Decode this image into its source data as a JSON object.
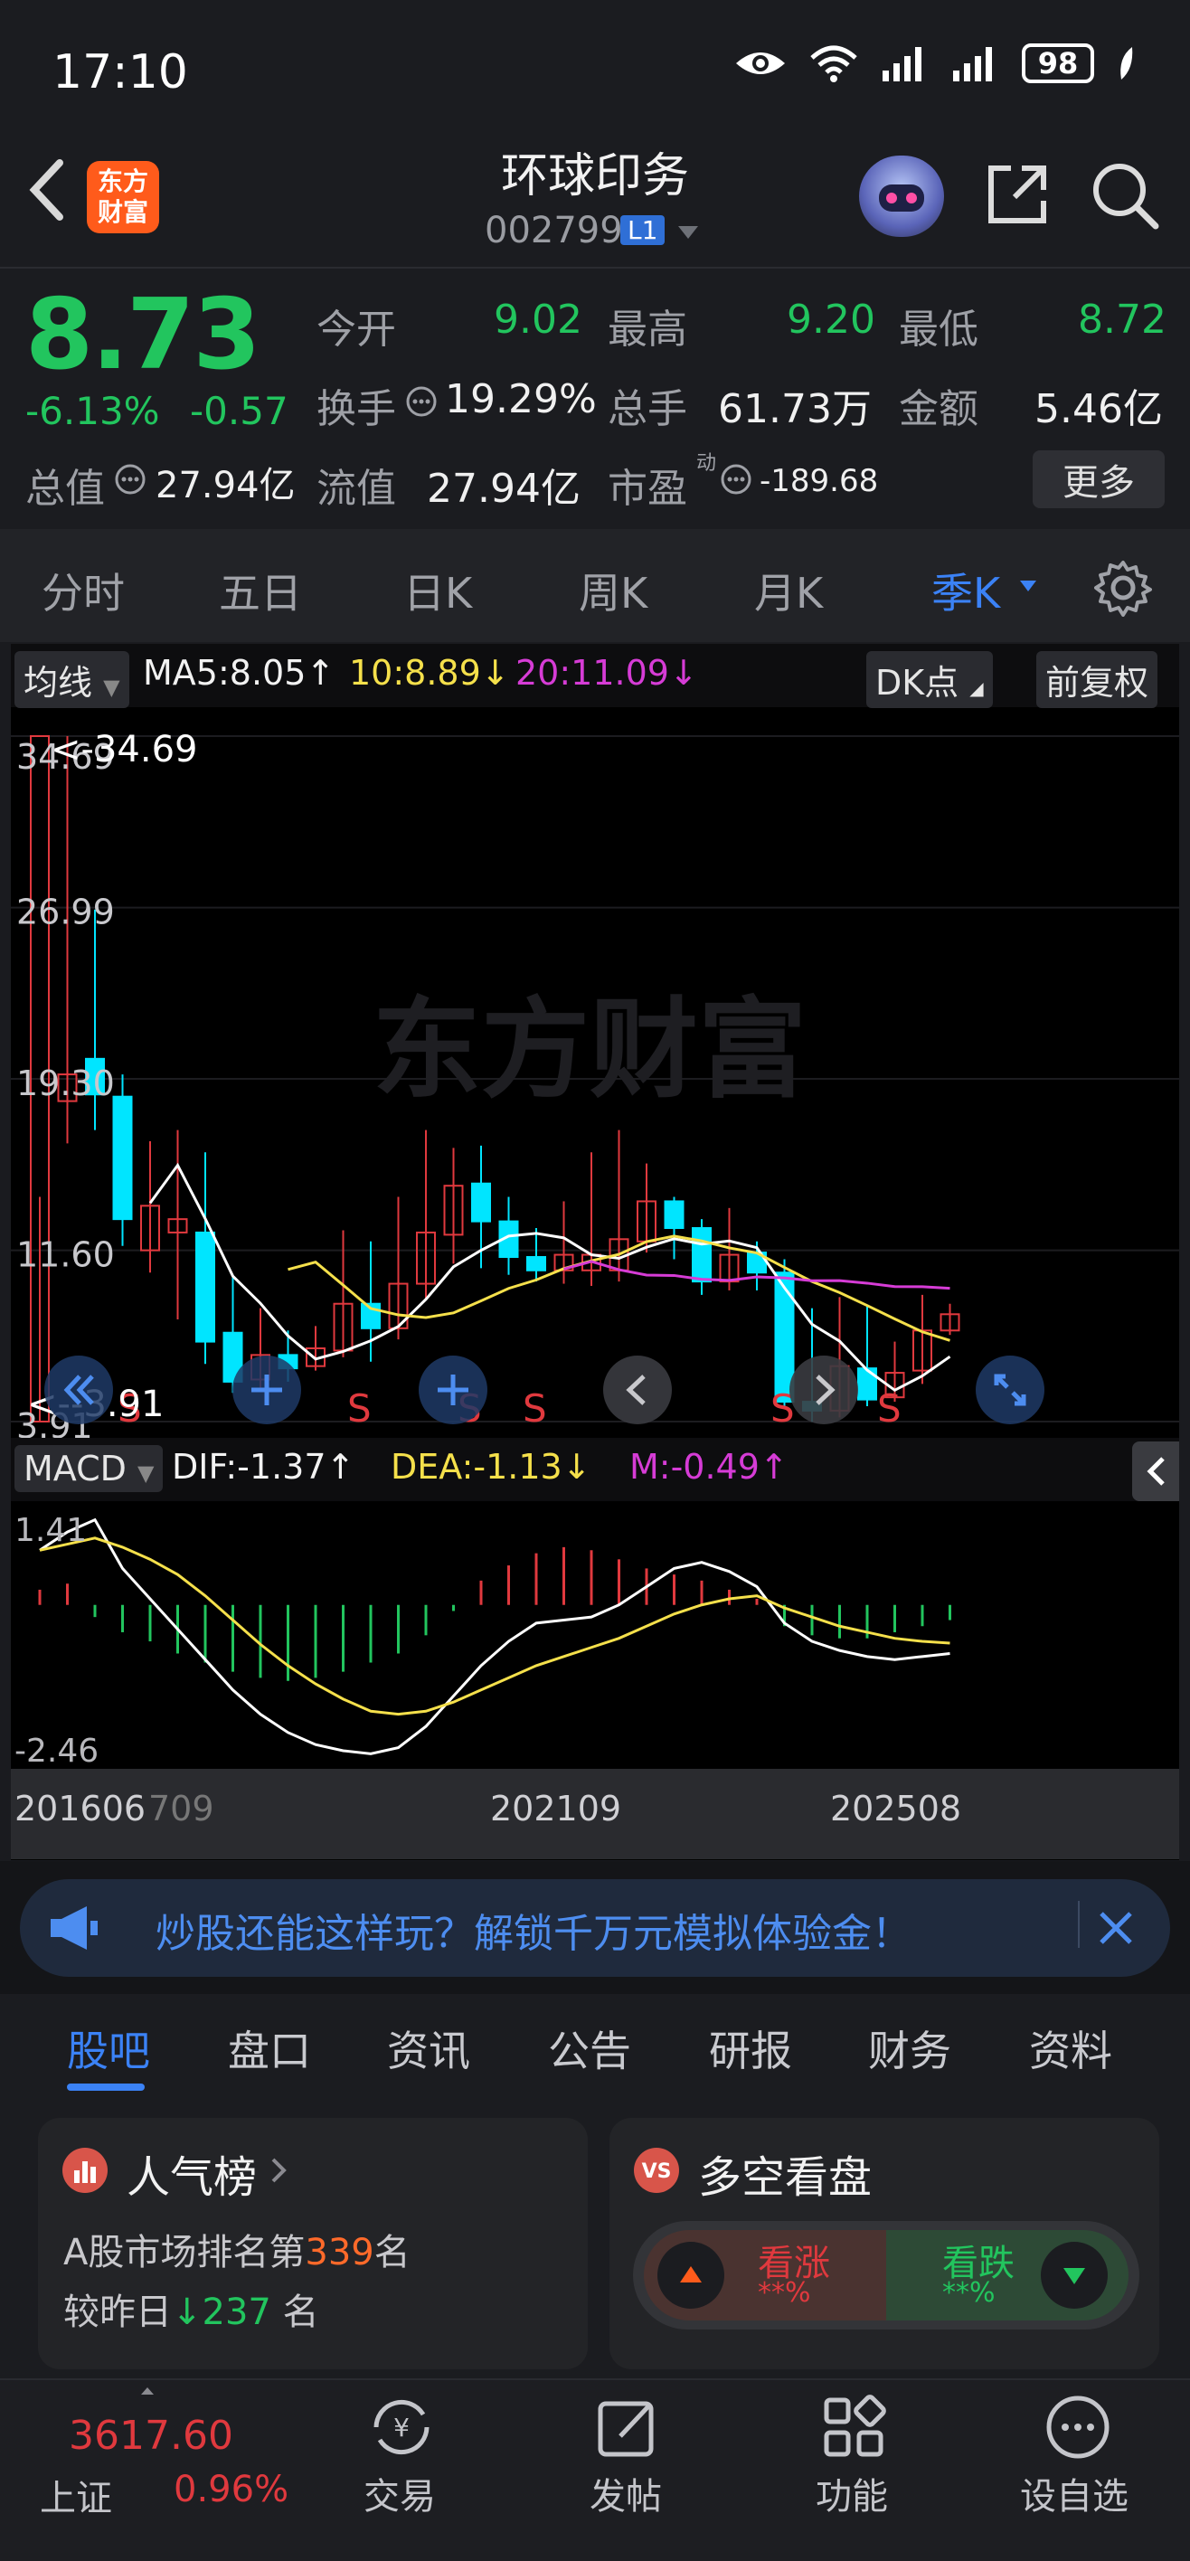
{
  "status": {
    "time": "17:10",
    "battery": "98"
  },
  "header": {
    "title": "环球印务",
    "code": "002799",
    "level": "L1",
    "logo_line1": "东方",
    "logo_line2": "财富"
  },
  "quote": {
    "price": "8.73",
    "pct": "-6.13%",
    "change": "-0.57",
    "open_label": "今开",
    "open": "9.02",
    "high_label": "最高",
    "high": "9.20",
    "low_label": "最低",
    "low": "8.72",
    "turnover_label": "换手",
    "turnover": "19.29%",
    "volume_label": "总手",
    "volume": "61.73万",
    "amount_label": "金额",
    "amount": "5.46亿",
    "mktcap_label": "总值",
    "mktcap": "27.94亿",
    "float_label": "流值",
    "float": "27.94亿",
    "pe_label": "市盈",
    "pe_sup": "动",
    "pe": "-189.68",
    "more": "更多"
  },
  "tabs": [
    "分时",
    "五日",
    "日K",
    "周K",
    "月K",
    "季K"
  ],
  "ma_row": {
    "label": "均线",
    "ma5": "MA5:8.05↑",
    "ma10": "10:8.89↓",
    "ma20": "20:11.09↓",
    "dk": "DK点",
    "adj": "前复权"
  },
  "chart_data": {
    "type": "candlestick",
    "title": "",
    "y_ticks": [
      "34.69",
      "26.99",
      "19.30",
      "11.60",
      "3.91"
    ],
    "ylim": [
      3.91,
      34.69
    ],
    "max_label": "<-34.69",
    "min_label": "<--3.91",
    "watermark": "东方财富",
    "signals": [
      "S",
      "S",
      "S",
      "S",
      "S",
      "S"
    ]
  },
  "macd": {
    "label": "MACD",
    "dif": "DIF:-1.37↑",
    "dea": "DEA:-1.13↓",
    "m": "M:-0.49↑",
    "top": "1.41",
    "bottom": "-2.46",
    "x_labels": [
      "201606",
      "709",
      "202109",
      "202508"
    ]
  },
  "banner": {
    "text": "炒股还能这样玩？解锁千万元模拟体验金！"
  },
  "bottom_tabs": [
    "股吧",
    "盘口",
    "资讯",
    "公告",
    "研报",
    "财务",
    "资料"
  ],
  "cards": {
    "hot": {
      "title": "人气榜",
      "line1_pre": "A股市场排名第",
      "rank": "339",
      "line1_post": "名",
      "line2_pre": "较昨日",
      "delta": "237",
      "line2_post": "名"
    },
    "vs": {
      "title": "多空看盘",
      "up": "看涨",
      "down": "看跌",
      "up_pct": "**%",
      "down_pct": "**%"
    }
  },
  "nav": {
    "index_value": "3617.60",
    "index_name": "上证",
    "index_pct": "0.96%",
    "items": [
      "交易",
      "发帖",
      "功能",
      "设自选"
    ]
  },
  "colors": {
    "up": "#e0393e",
    "down": "#22c55e",
    "accent": "#3b82f6",
    "cyan": "#00e5ff",
    "ma10": "#f5e04b",
    "ma20": "#d63cd6"
  }
}
